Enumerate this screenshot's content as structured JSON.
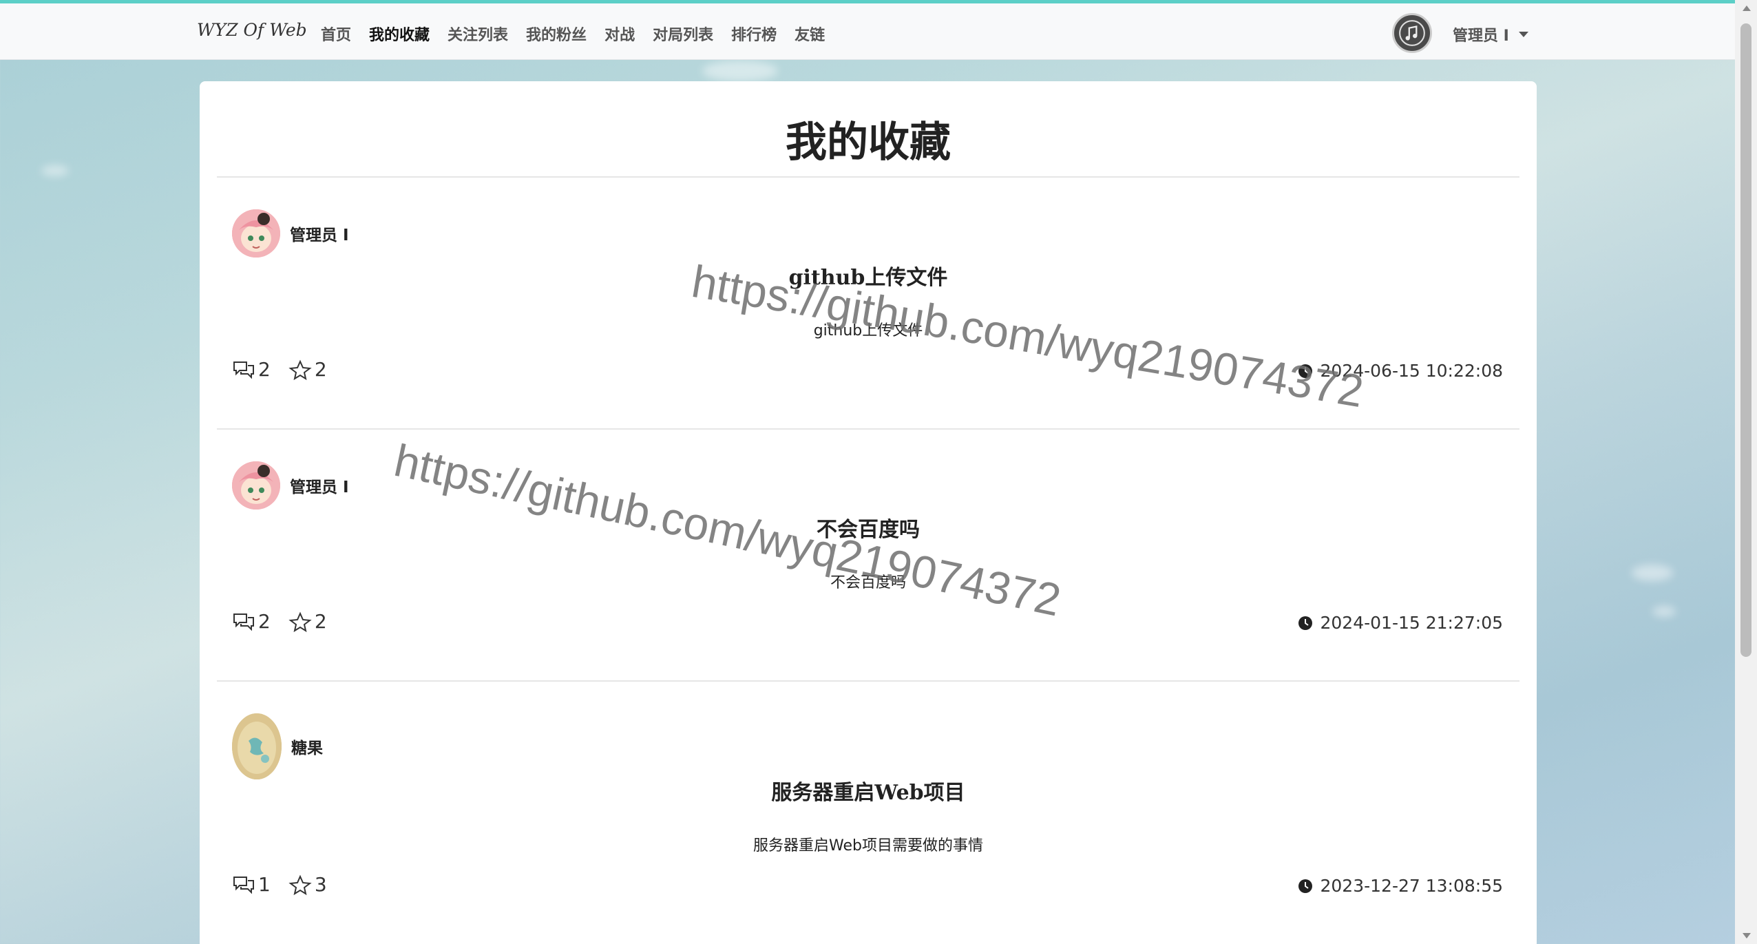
{
  "navbar": {
    "brand": "WYZ Of Web",
    "links": [
      "首页",
      "我的收藏",
      "关注列表",
      "我的粉丝",
      "对战",
      "对局列表",
      "排行榜",
      "友链"
    ],
    "active_index": 1,
    "user": "管理员 I"
  },
  "page": {
    "title": "我的收藏"
  },
  "posts": [
    {
      "author": "管理员 I",
      "avatar": "anya-avatar",
      "title": "github上传文件",
      "summary": "github上传文件",
      "comments": "2",
      "stars": "2",
      "time": "2024-06-15 10:22:08"
    },
    {
      "author": "管理员 I",
      "avatar": "anya-avatar",
      "title": "不会百度吗",
      "summary": "不会百度吗",
      "comments": "2",
      "stars": "2",
      "time": "2024-01-15 21:27:05"
    },
    {
      "author": "糖果",
      "avatar": "candy-avatar",
      "title": "服务器重启Web项目",
      "summary": "服务器重启Web项目需要做的事情",
      "comments": "1",
      "stars": "3",
      "time": "2023-12-27 13:08:55"
    }
  ],
  "watermarks": [
    "https://github.com/wyq219074372",
    "https://github.com/wyq219074372"
  ],
  "colors": {
    "accent_topline": "#5ccfc7",
    "navbar_bg": "#f8f9fa",
    "card_bg": "#ffffff"
  }
}
